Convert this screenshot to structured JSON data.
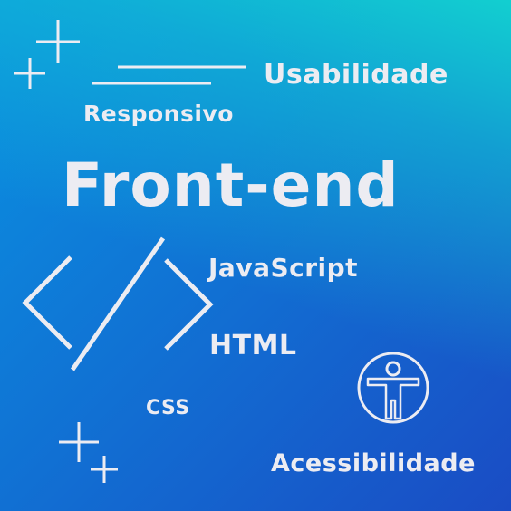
{
  "words": {
    "usabilidade": "Usabilidade",
    "responsivo": "Responsivo",
    "title": "Front-end",
    "javascript": "JavaScript",
    "html": "HTML",
    "css": "CSS",
    "acessibilidade": "Acessibilidade"
  },
  "colors": {
    "text": "#ececf2",
    "gradient_top_right": "#12d4d0",
    "gradient_bottom_left": "#1a4cc4"
  },
  "icons": [
    "sparkle-icon",
    "code-brackets-icon",
    "accessibility-icon"
  ]
}
